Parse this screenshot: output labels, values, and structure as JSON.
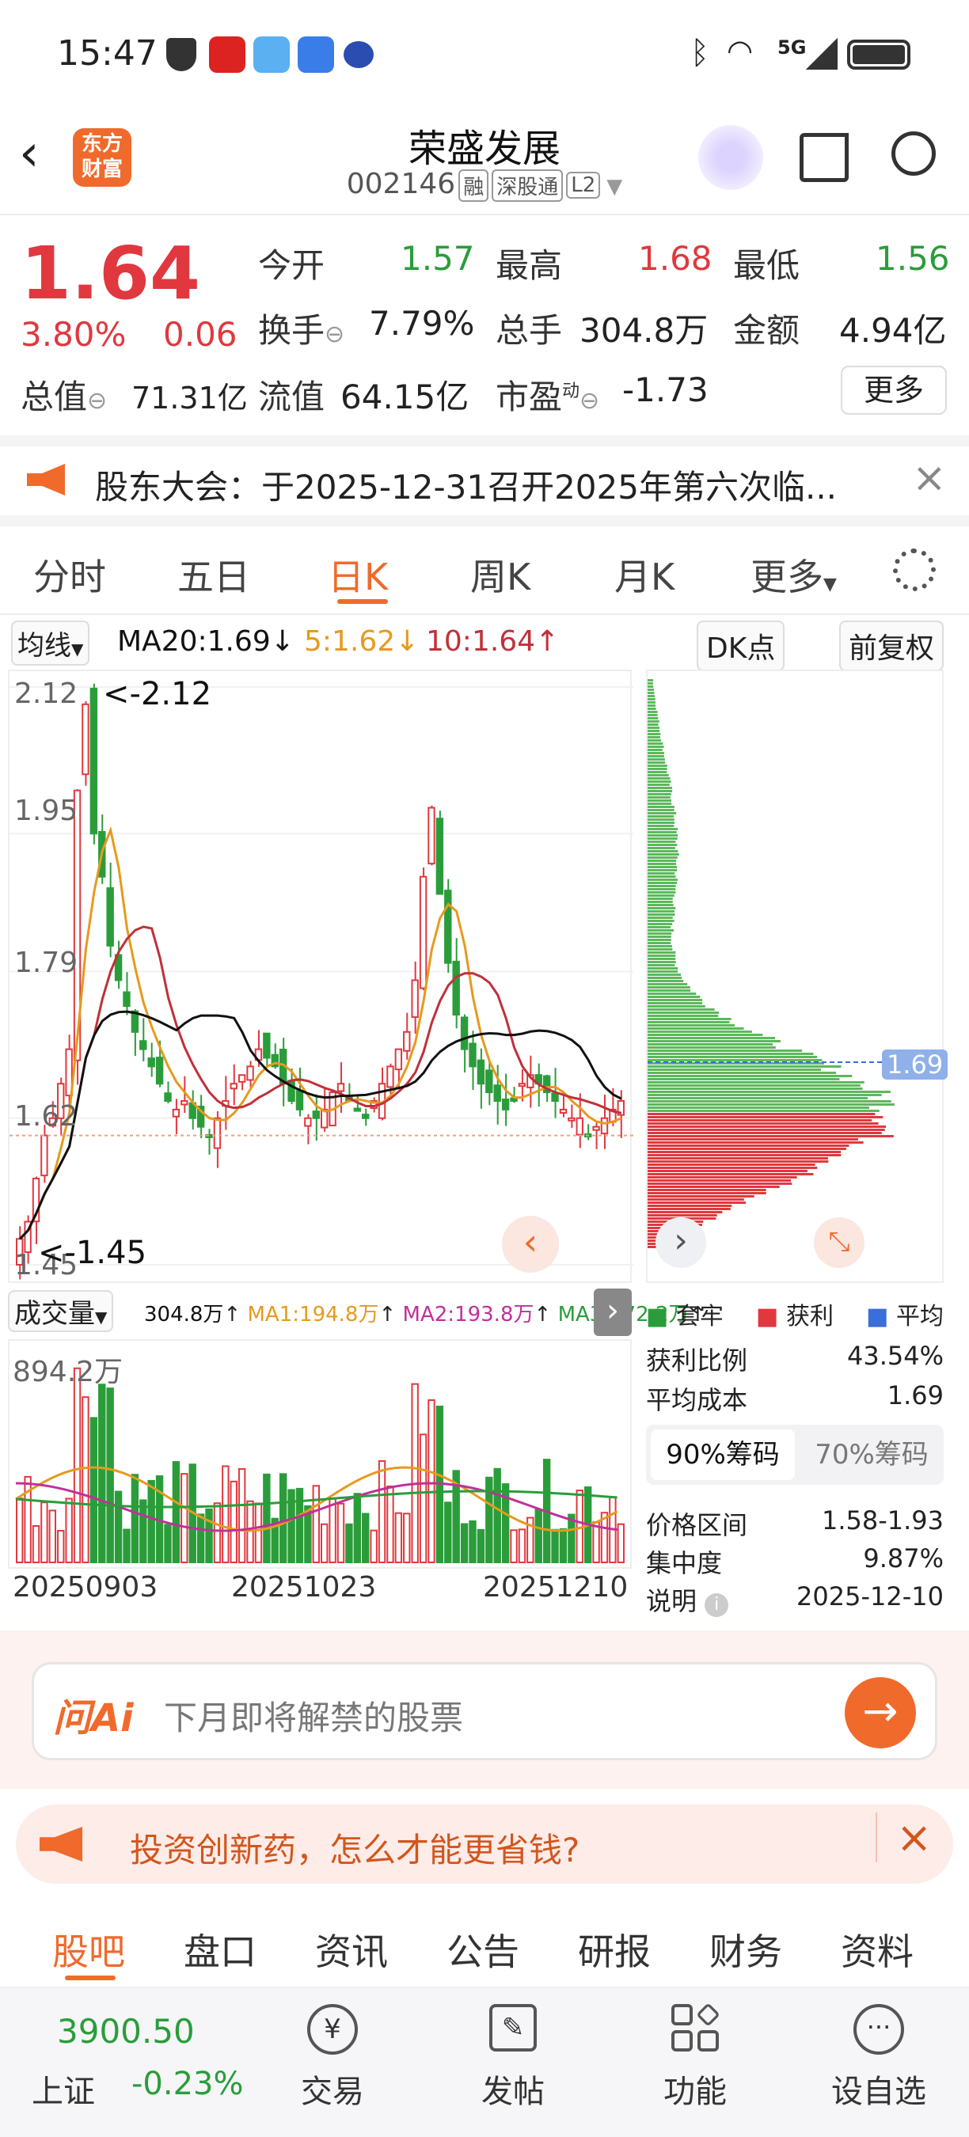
{
  "status_bar": {
    "time": "15:47",
    "network": "5G"
  },
  "header": {
    "logo_text_1": "东方",
    "logo_text_2": "财富",
    "title": "荣盛发展",
    "code": "002146",
    "tags": [
      "融",
      "深股通",
      "L2"
    ]
  },
  "quote": {
    "price": "1.64",
    "change_pct": "3.80%",
    "change": "0.06",
    "total_value_label": "总值",
    "total_value": "71.31亿",
    "fields": [
      {
        "label": "今开",
        "value": "1.57"
      },
      {
        "label": "最高",
        "value": "1.68"
      },
      {
        "label": "最低",
        "value": "1.56"
      },
      {
        "label": "换手",
        "value": "7.79%"
      },
      {
        "label": "总手",
        "value": "304.8万"
      },
      {
        "label": "金额",
        "value": "4.94亿"
      },
      {
        "label": "流值",
        "value": "64.15亿"
      },
      {
        "label": "市盈",
        "value": "-1.73"
      }
    ],
    "pe_sup": "动",
    "more_button": "更多"
  },
  "notice": {
    "text": "股东大会：于2025-12-31召开2025年第六次临..."
  },
  "tabs": [
    {
      "label": "分时"
    },
    {
      "label": "五日"
    },
    {
      "label": "日K"
    },
    {
      "label": "周K"
    },
    {
      "label": "月K"
    },
    {
      "label": "更多"
    }
  ],
  "chart_toolbar": {
    "indicator": "均线",
    "ma20": "MA20:1.69",
    "ma5": "5:1.62",
    "ma10": "10:1.64",
    "dk_button": "DK点",
    "adjust_button": "前复权"
  },
  "chart_data": {
    "type": "candlestick",
    "y_ticks": [
      "2.12",
      "1.95",
      "1.79",
      "1.62",
      "1.45"
    ],
    "high_label": "<-2.12",
    "low_label": "<-1.45",
    "chips_avg_label": "1.69",
    "dates": [
      "20250903",
      "20251023",
      "20251210"
    ],
    "volume_label": "成交量",
    "volume_values": {
      "vol": "304.8万",
      "ma1": "MA1:194.8万",
      "ma2": "MA2:193.8万",
      "ma3": "MA3:272.2万"
    },
    "volume_max_label": "894.2万",
    "colors": {
      "up": "#e0383e",
      "down": "#2a9d3a",
      "ma5": "#e69a1e",
      "ma10": "#c0303a",
      "ma20": "#111111"
    }
  },
  "chip_info": {
    "legend": [
      {
        "label": "套牢",
        "color": "#2a9d3a"
      },
      {
        "label": "获利",
        "color": "#e0383e"
      },
      {
        "label": "平均",
        "color": "#3a6ed8"
      }
    ],
    "rows1": [
      {
        "label": "获利比例",
        "value": "43.54%"
      },
      {
        "label": "平均成本",
        "value": "1.69"
      }
    ],
    "tabs": [
      "90%筹码",
      "70%筹码"
    ],
    "rows2": [
      {
        "label": "价格区间",
        "value": "1.58-1.93"
      },
      {
        "label": "集中度",
        "value": "9.87%"
      },
      {
        "label": "说明",
        "value": "2025-12-10"
      }
    ]
  },
  "ask_ai": {
    "logo": "问Ai",
    "placeholder": "下月即将解禁的股票"
  },
  "ad": {
    "text": "投资创新药，怎么才能更省钱?"
  },
  "bottom_tabs": [
    "股吧",
    "盘口",
    "资讯",
    "公告",
    "研报",
    "财务",
    "资料"
  ],
  "navbar": {
    "index_value": "3900.50",
    "index_name": "上证",
    "index_change": "-0.23%",
    "items": [
      {
        "label": "交易"
      },
      {
        "label": "发帖"
      },
      {
        "label": "功能"
      },
      {
        "label": "设自选"
      }
    ]
  }
}
